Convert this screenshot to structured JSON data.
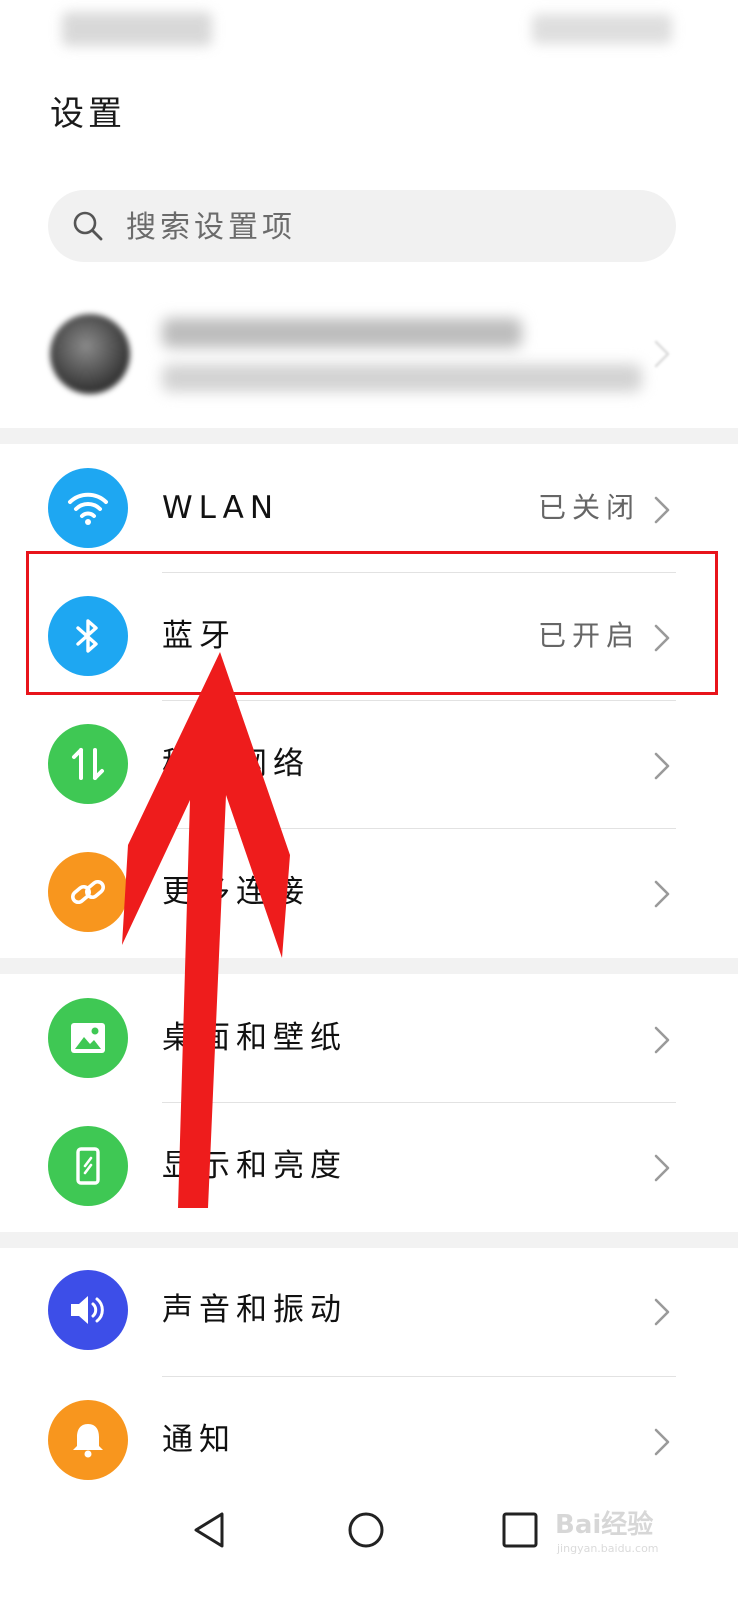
{
  "header": {
    "title": "设置"
  },
  "search": {
    "placeholder": "搜索设置项"
  },
  "sections": {
    "connectivity": [
      {
        "label": "WLAN",
        "value": "已关闭",
        "icon": "wifi-icon",
        "color": "#1ea7f2"
      },
      {
        "label": "蓝牙",
        "value": "已开启",
        "icon": "bluetooth-icon",
        "color": "#1ea7f2"
      },
      {
        "label": "移动网络",
        "value": "",
        "icon": "mobile-data-icon",
        "color": "#3fc854"
      },
      {
        "label": "更多连接",
        "value": "",
        "icon": "link-icon",
        "color": "#f8961e"
      }
    ],
    "display": [
      {
        "label": "桌面和壁纸",
        "icon": "image-icon",
        "color": "#3fc854"
      },
      {
        "label": "显示和亮度",
        "icon": "phone-display-icon",
        "color": "#3fc854"
      }
    ],
    "sound": [
      {
        "label": "声音和振动",
        "icon": "speaker-icon",
        "color": "#3d4ee8"
      },
      {
        "label": "通知",
        "icon": "bell-icon",
        "color": "#f8961e"
      }
    ]
  },
  "annotation": {
    "color": "#e8141b"
  },
  "watermark": {
    "text": "Bai经验",
    "sub": "jingyan.baidu.com"
  }
}
